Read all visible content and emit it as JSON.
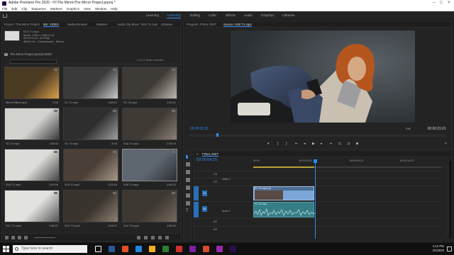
{
  "window": {
    "title": "Adobe Premiere Pro 2020 - H:\\The Mirror\\The Mirror Project.prproj *"
  },
  "menu": [
    "File",
    "Edit",
    "Clip",
    "Sequence",
    "Markers",
    "Graphics",
    "View",
    "Window",
    "Help"
  ],
  "workspaces": {
    "tabs": [
      "Learning",
      "Assembly",
      "Editing",
      "Color",
      "Effects",
      "Audio",
      "Graphics",
      "Libraries"
    ],
    "active": "Assembly"
  },
  "project_panel": {
    "tabs": [
      "Project: The Mirror Project",
      "Bin: VIDEO",
      "Media Browser",
      "Markers",
      "Audio Clip Mixer: S1B T1.mp4",
      "Libraries"
    ],
    "active_tab": "Bin: VIDEO",
    "clip_info": {
      "name": "S1C T1.mp4",
      "line1": "Movie, 1920 x 1080 (1.0)",
      "line2": "00:00:01:21, 23.976p",
      "line3": "48000 Hz - Compressed - Stereo"
    },
    "breadcrumb": "The Mirror Project.prproj\\VIDEO",
    "selection_count": "1 of 27 items selected",
    "clips": [
      {
        "name": "Mirror Effect.mp4",
        "duration": "5:00"
      },
      {
        "name": "S1 T1.mp4",
        "duration": "1:08:21"
      },
      {
        "name": "S1 T3.mp4",
        "duration": "1:06:21"
      },
      {
        "name": "S1 T2.mp4",
        "duration": "1:06:02"
      },
      {
        "name": "S1 T4.mp4",
        "duration": "8:23"
      },
      {
        "name": "S1A T1.mp4",
        "duration": "1:03:19"
      },
      {
        "name": "S1A T1.mp4",
        "duration": "1:02:04"
      },
      {
        "name": "S1A T2.mp4",
        "duration": "1:03:18"
      },
      {
        "name": "S1B T1.mp4",
        "duration": "1:06:21"
      },
      {
        "name": "S1C T1.mp4",
        "duration": "1:06:21"
      },
      {
        "name": "S1C T2.mp4",
        "duration": "1:03:07"
      },
      {
        "name": "S1C T3.mp4",
        "duration": "1:08:22"
      }
    ],
    "selected_clip_index": 8
  },
  "monitor": {
    "tabs": [
      "Program: FINAL EDIT",
      "Source: S1B T1.mp4"
    ],
    "active_tab": "Source: S1B T1.mp4",
    "timecode_in": "00:00:11:21",
    "timecode_total": "00:00:21:01",
    "fit": "Full",
    "controls": [
      "marker",
      "in",
      "out",
      "step-back",
      "play",
      "step-forward",
      "insert",
      "overwrite",
      "export-frame"
    ]
  },
  "timeline": {
    "title": "FINAL EDIT",
    "timecode": "00:00:04:20",
    "ruler": [
      "00:00",
      "00:00:04:23",
      "00:00:09:23",
      "00:00:14:23"
    ],
    "tracks": {
      "video": [
        "V3",
        "V2",
        "V1"
      ],
      "audio": [
        "A1",
        "A2",
        "A3"
      ],
      "video_names": [
        "Video 1"
      ],
      "audio_names": [
        "Audio 1"
      ]
    },
    "video_clip": "S1 T4.mp4 [V]",
    "audio_clip": "S1 T4.mp4"
  },
  "taskbar": {
    "search_placeholder": "Type here to search",
    "time": "3:13 PM",
    "date": "4/1/2020",
    "app_colors": [
      "#2b579a",
      "#e34e26",
      "#1e88e5",
      "#f2b01e",
      "#2e7d32",
      "#d32f2f",
      "#7b1fa2",
      "#d64b2a",
      "#9c27b0",
      "#2a0e4a"
    ]
  }
}
